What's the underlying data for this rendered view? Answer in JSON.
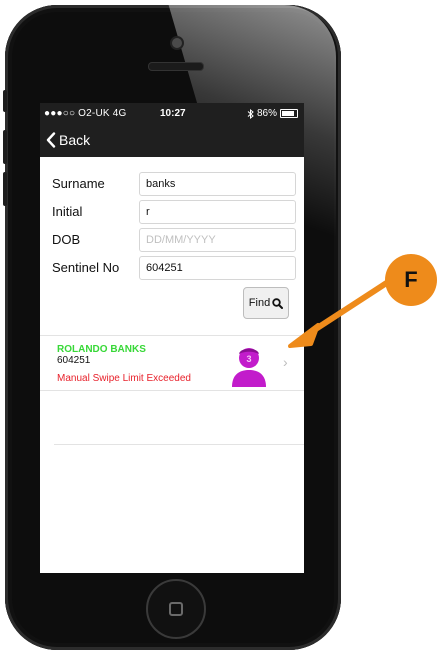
{
  "status_bar": {
    "carrier": "●●●○○ O2-UK  4G",
    "time": "10:27",
    "battery_text": "86%",
    "battery_level": 0.86,
    "bluetooth_icon": "bluetooth-icon"
  },
  "nav": {
    "back_label": "Back",
    "back_icon": "chevron-left-icon"
  },
  "form": {
    "surname_label": "Surname",
    "surname_value": "banks",
    "initial_label": "Initial",
    "initial_value": "r",
    "dob_label": "DOB",
    "dob_placeholder": "DD/MM/YYYY",
    "sentinel_label": "Sentinel No",
    "sentinel_value": "604251"
  },
  "find_button": {
    "label": "Find",
    "icon": "search-icon"
  },
  "result": {
    "name": "ROLANDO BANKS",
    "id": "604251",
    "warning": "Manual Swipe Limit Exceeded",
    "avatar_number": "3",
    "name_color": "#38d838",
    "warning_color": "#e8212b",
    "avatar_color": "#c21ccb"
  },
  "annotation": {
    "label": "F",
    "color": "#ee8b1b"
  }
}
